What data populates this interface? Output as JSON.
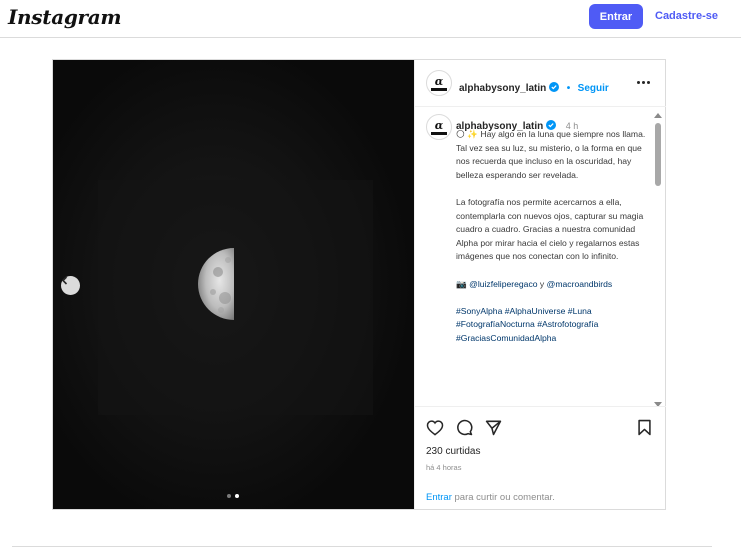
{
  "nav": {
    "logo": "Instagram",
    "login_label": "Entrar",
    "signup_label": "Cadastre-se"
  },
  "post": {
    "username": "alphabysony_latin",
    "follow_label": "Seguir",
    "separator": "•",
    "caption": {
      "time": "4 h",
      "emojis": "🌕 ✨",
      "p1": "Hay algo en la luna que siempre nos llama. Tal vez sea su luz, su misterio, o la forma en que nos recuerda que incluso en la oscuridad, hay belleza esperando ser revelada.",
      "p2": "La fotografía nos permite acercarnos a ella, contemplarla con nuevos ojos, capturar su magia cuadro a cuadro. Gracias a nuestra comunidad Alpha por mirar hacia el cielo y regalarnos estas imágenes que nos conectan con lo infinito.",
      "camera_emoji": "📷",
      "credit_1": "@luizfeliperegaco",
      "credit_join": " y",
      "credit_2": "@macroandbirds",
      "hashtags": "#SonyAlpha #AlphaUniverse #Luna #FotografíaNocturna #Astrofotografía #GraciasComunidadAlpha"
    },
    "likes": "230 curtidas",
    "time_ago": "há 4 horas",
    "comment_link": "Entrar",
    "comment_rest": " para curtir ou comentar.",
    "carousel": {
      "slide_count": 2,
      "active_slide": 2
    }
  },
  "colors": {
    "accent": "#4f5bf5",
    "link": "#0095f6",
    "hashtag": "#00376b",
    "verified": "#0095f6"
  },
  "icons": [
    "alpha-logo-icon",
    "verified-badge-icon",
    "more-options-icon",
    "chevron-left-icon",
    "heart-icon",
    "comment-icon",
    "share-icon",
    "bookmark-icon"
  ]
}
